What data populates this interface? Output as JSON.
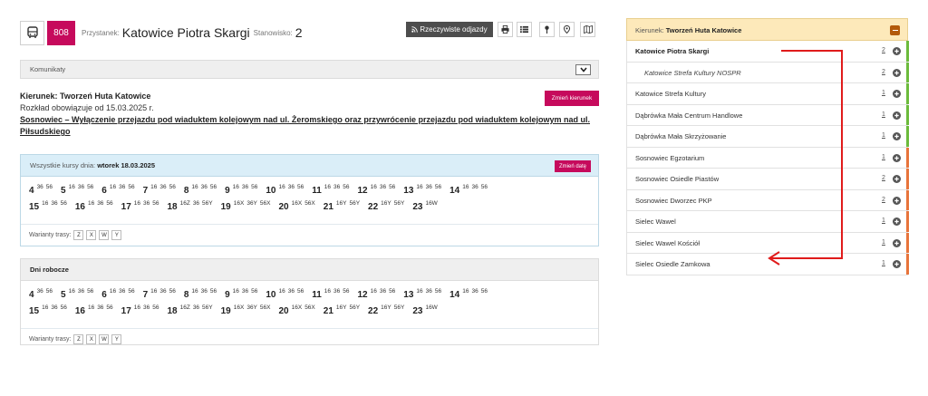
{
  "header": {
    "line_number": "808",
    "stop_label": "Przystanek:",
    "stop_name": "Katowice Piotra Skargi",
    "stanowisko_label": "Stanowisko:",
    "stanowisko_number": "2",
    "realtime_button": "Rzeczywiste odjazdy",
    "toolbar_icons": [
      "print-icon",
      "list-icon",
      "pin-icon",
      "map-pin-icon",
      "map-icon"
    ]
  },
  "announcements": {
    "label": "Komunikaty"
  },
  "direction": {
    "label": "Kierunek: Tworzeń Huta Katowice",
    "valid_from": "Rozkład obowiązuje od 15.03.2025 r.",
    "notice": "Sosnowiec – Wyłączenie przejazdu pod wiaduktem kolejowym nad ul. Żeromskiego oraz przywrócenie przejazdu pod wiaduktem kolejowym nad ul. Piłsudskiego",
    "change_direction_button": "Zmień kierunek"
  },
  "all_courses": {
    "label_prefix": "Wszystkie kursy dnia:",
    "day": "wtorek 18.03.2025",
    "change_date_button": "Zmień datę",
    "rows": [
      [
        {
          "h": "4",
          "m": [
            "36",
            "56"
          ]
        },
        {
          "h": "5",
          "m": [
            "16",
            "36",
            "56"
          ]
        },
        {
          "h": "6",
          "m": [
            "16",
            "36",
            "56"
          ]
        },
        {
          "h": "7",
          "m": [
            "16",
            "36",
            "56"
          ]
        },
        {
          "h": "8",
          "m": [
            "16",
            "36",
            "56"
          ]
        },
        {
          "h": "9",
          "m": [
            "16",
            "36",
            "56"
          ]
        },
        {
          "h": "10",
          "m": [
            "16",
            "36",
            "56"
          ]
        },
        {
          "h": "11",
          "m": [
            "16",
            "36",
            "56"
          ]
        },
        {
          "h": "12",
          "m": [
            "16",
            "36",
            "56"
          ]
        },
        {
          "h": "13",
          "m": [
            "16",
            "36",
            "56"
          ]
        },
        {
          "h": "14",
          "m": [
            "16",
            "36",
            "56"
          ]
        }
      ],
      [
        {
          "h": "15",
          "m": [
            "16",
            "36",
            "56"
          ]
        },
        {
          "h": "16",
          "m": [
            "16",
            "36",
            "56"
          ]
        },
        {
          "h": "17",
          "m": [
            "16",
            "36",
            "56"
          ]
        },
        {
          "h": "18",
          "m": [
            "16Z",
            "36",
            "56Y"
          ]
        },
        {
          "h": "19",
          "m": [
            "16X",
            "36Y",
            "56X"
          ]
        },
        {
          "h": "20",
          "m": [
            "16X",
            "56X"
          ]
        },
        {
          "h": "21",
          "m": [
            "16Y",
            "56Y"
          ]
        },
        {
          "h": "22",
          "m": [
            "16Y",
            "56Y"
          ]
        },
        {
          "h": "23",
          "m": [
            "16W"
          ]
        }
      ]
    ],
    "variants_label": "Warianty trasy:",
    "variants": [
      "Z",
      "X",
      "W",
      "Y"
    ]
  },
  "weekdays": {
    "label": "Dni robocze",
    "rows": [
      [
        {
          "h": "4",
          "m": [
            "36",
            "56"
          ]
        },
        {
          "h": "5",
          "m": [
            "16",
            "36",
            "56"
          ]
        },
        {
          "h": "6",
          "m": [
            "16",
            "36",
            "56"
          ]
        },
        {
          "h": "7",
          "m": [
            "16",
            "36",
            "56"
          ]
        },
        {
          "h": "8",
          "m": [
            "16",
            "36",
            "56"
          ]
        },
        {
          "h": "9",
          "m": [
            "16",
            "36",
            "56"
          ]
        },
        {
          "h": "10",
          "m": [
            "16",
            "36",
            "56"
          ]
        },
        {
          "h": "11",
          "m": [
            "16",
            "36",
            "56"
          ]
        },
        {
          "h": "12",
          "m": [
            "16",
            "36",
            "56"
          ]
        },
        {
          "h": "13",
          "m": [
            "16",
            "36",
            "56"
          ]
        },
        {
          "h": "14",
          "m": [
            "16",
            "36",
            "56"
          ]
        }
      ],
      [
        {
          "h": "15",
          "m": [
            "16",
            "36",
            "56"
          ]
        },
        {
          "h": "16",
          "m": [
            "16",
            "36",
            "56"
          ]
        },
        {
          "h": "17",
          "m": [
            "16",
            "36",
            "56"
          ]
        },
        {
          "h": "18",
          "m": [
            "16Z",
            "36",
            "56Y"
          ]
        },
        {
          "h": "19",
          "m": [
            "16X",
            "36Y",
            "56X"
          ]
        },
        {
          "h": "20",
          "m": [
            "16X",
            "56X"
          ]
        },
        {
          "h": "21",
          "m": [
            "16Y",
            "56Y"
          ]
        },
        {
          "h": "22",
          "m": [
            "16Y",
            "56Y"
          ]
        },
        {
          "h": "23",
          "m": [
            "16W"
          ]
        }
      ]
    ],
    "variants_label": "Warianty trasy:",
    "variants": [
      "Z",
      "X",
      "W",
      "Y"
    ]
  },
  "route_panel": {
    "label_prefix": "Kierunek:",
    "direction": "Tworzeń Huta Katowice",
    "stops": [
      {
        "name": "Katowice Piotra Skargi",
        "zone": "2",
        "current": true,
        "sub": false,
        "bar": "#6cbb3c"
      },
      {
        "name": "Katowice Strefa Kultury NOSPR",
        "zone": "2",
        "current": false,
        "sub": true,
        "bar": "#6cbb3c"
      },
      {
        "name": "Katowice Strefa Kultury",
        "zone": "1",
        "current": false,
        "sub": false,
        "bar": "#6cbb3c"
      },
      {
        "name": "Dąbrówka Mała Centrum Handlowe",
        "zone": "1",
        "current": false,
        "sub": false,
        "bar": "#6cbb3c"
      },
      {
        "name": "Dąbrówka Mała Skrzyżowanie",
        "zone": "1",
        "current": false,
        "sub": false,
        "bar": "#6cbb3c"
      },
      {
        "name": "Sosnowiec Egzotarium",
        "zone": "1",
        "current": false,
        "sub": false,
        "bar": "#e8743b"
      },
      {
        "name": "Sosnowiec Osiedle Piastów",
        "zone": "2",
        "current": false,
        "sub": false,
        "bar": "#e8743b"
      },
      {
        "name": "Sosnowiec Dworzec PKP",
        "zone": "2",
        "current": false,
        "sub": false,
        "bar": "#e8743b"
      },
      {
        "name": "Sielec Wawel",
        "zone": "1",
        "current": false,
        "sub": false,
        "bar": "#e8743b"
      },
      {
        "name": "Sielec Wawel Kościół",
        "zone": "1",
        "current": false,
        "sub": false,
        "bar": "#e8743b"
      },
      {
        "name": "Sielec Osiedle Zamkowa",
        "zone": "1",
        "current": false,
        "sub": false,
        "bar": "#e8743b"
      }
    ]
  },
  "colors": {
    "brand": "#c60a5c",
    "annotation_arrow": "#e01b1b"
  }
}
